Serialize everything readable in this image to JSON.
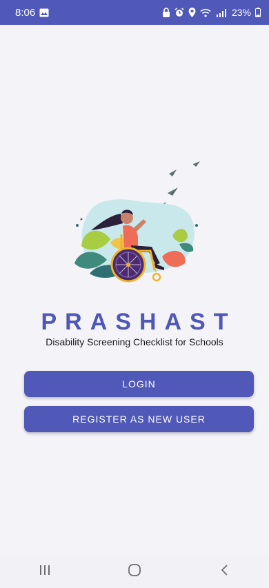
{
  "status_bar": {
    "time": "8:06",
    "battery": "23%",
    "background": "#5059b8",
    "icons": [
      "image-icon",
      "lock-icon",
      "alarm-icon",
      "location-icon",
      "wifi-icon",
      "signal-icon",
      "battery-icon"
    ]
  },
  "app": {
    "title": "PRASHAST",
    "subtitle": "Disability Screening Checklist for Schools",
    "accent": "#4f57b6"
  },
  "buttons": {
    "login_label": "LOGIN",
    "register_label": "REGISTER AS NEW USER"
  },
  "nav": {
    "icons": [
      "recent-apps-icon",
      "home-icon",
      "back-icon"
    ]
  }
}
